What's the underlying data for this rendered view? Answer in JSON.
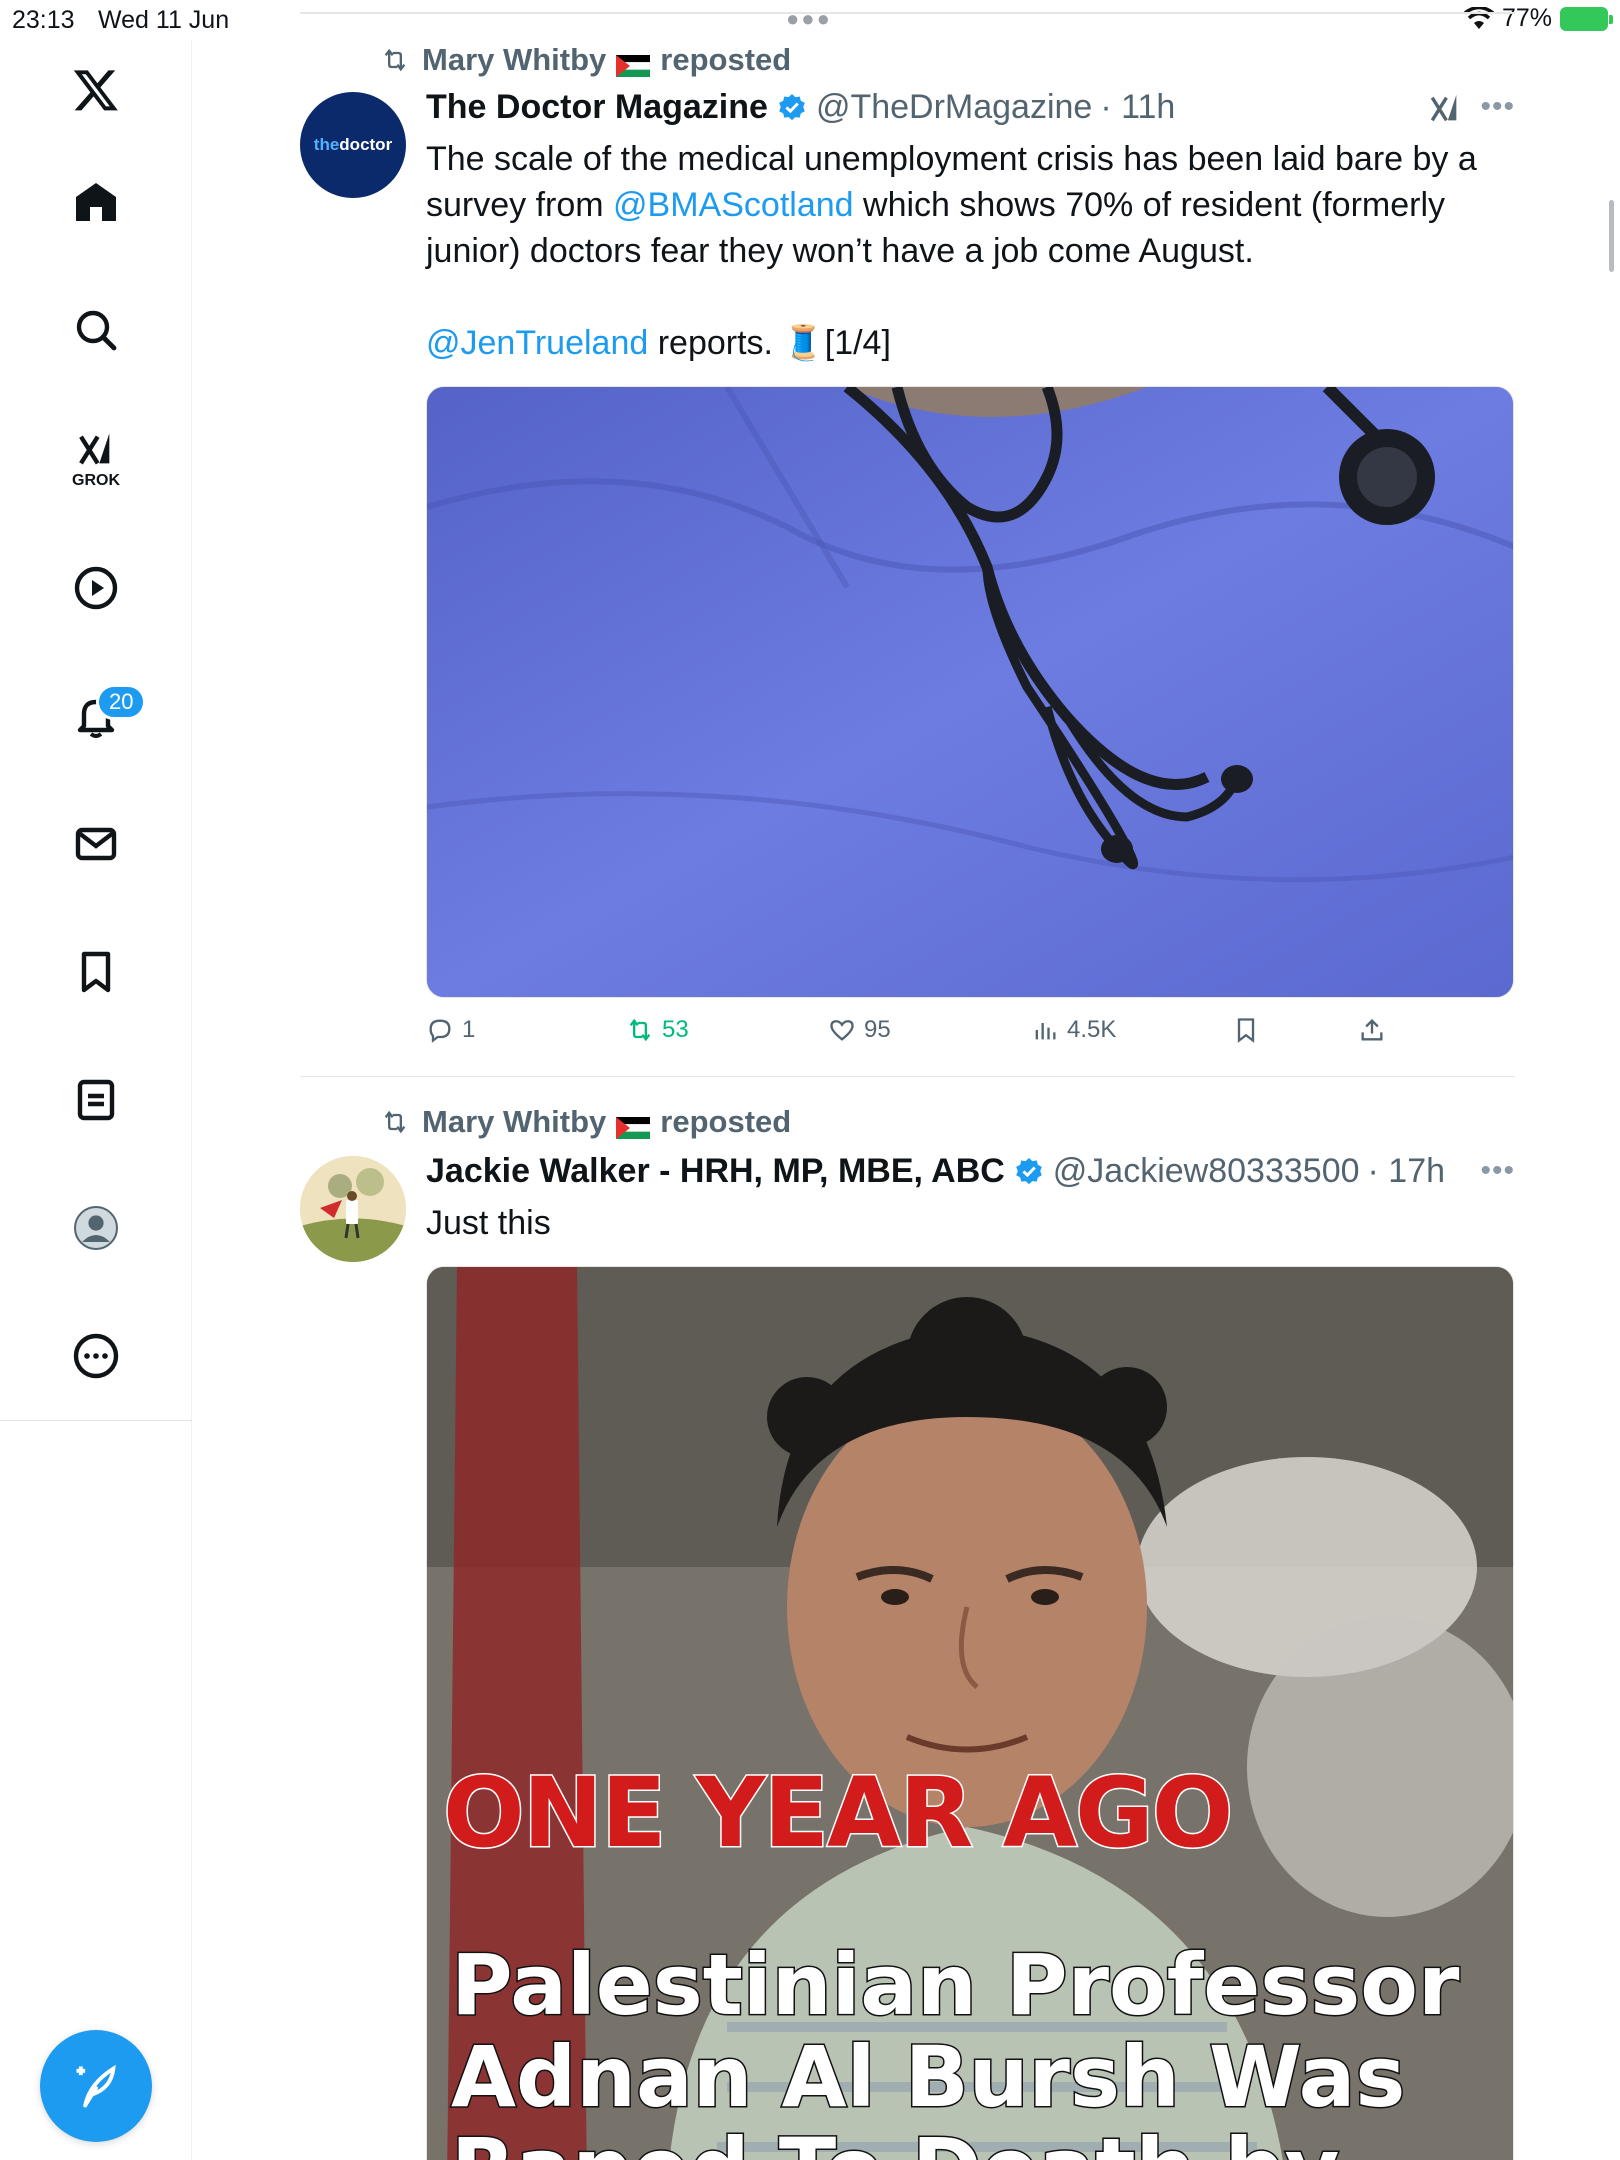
{
  "status_bar": {
    "time": "23:13",
    "date": "Wed 11 Jun",
    "battery": "77%"
  },
  "sidebar": {
    "grok_label": "GROK",
    "notifications_badge": "20",
    "items": [
      "x-logo",
      "home-icon",
      "search-icon",
      "grok-icon",
      "video-icon",
      "notifications-icon",
      "messages-icon",
      "bookmarks-icon",
      "lists-icon",
      "profile-icon",
      "more-icon"
    ]
  },
  "colors": {
    "accent": "#1d9bf0",
    "repost_green": "#00ba7c",
    "secondary_text": "#536471"
  },
  "posts": [
    {
      "reposted_by": "Mary Whitby",
      "reposted_label": "reposted",
      "author": "The Doctor Magazine",
      "avatar_text_a": "the",
      "avatar_text_b": "doctor",
      "handle": "@TheDrMagazine",
      "time": "· 11h",
      "text_line1": "The scale of the medical unemployment crisis has been laid bare by a",
      "text_line2a": "survey from ",
      "mention1": "@BMAScotland",
      "text_line2b": " which shows 70% of resident (formerly",
      "text_line3": "junior) doctors fear they won’t have a job come August.",
      "mention2": "@JenTrueland",
      "text_line4b": " reports. 🧵[1/4]",
      "replies": "1",
      "reposts": "53",
      "likes": "95",
      "views": "4.5K"
    },
    {
      "reposted_by": "Mary Whitby",
      "reposted_label": "reposted",
      "author": "Jackie Walker - HRH, MP, MBE, ABC",
      "handle": "@Jackiew80333500",
      "time": "· 17h",
      "text": "Just this",
      "meme_line1": "ONE YEAR AGO",
      "meme_line2": "Palestinian Professor",
      "meme_line3": "Adnan Al Bursh Was",
      "meme_line4": "Raped To Death by"
    }
  ]
}
